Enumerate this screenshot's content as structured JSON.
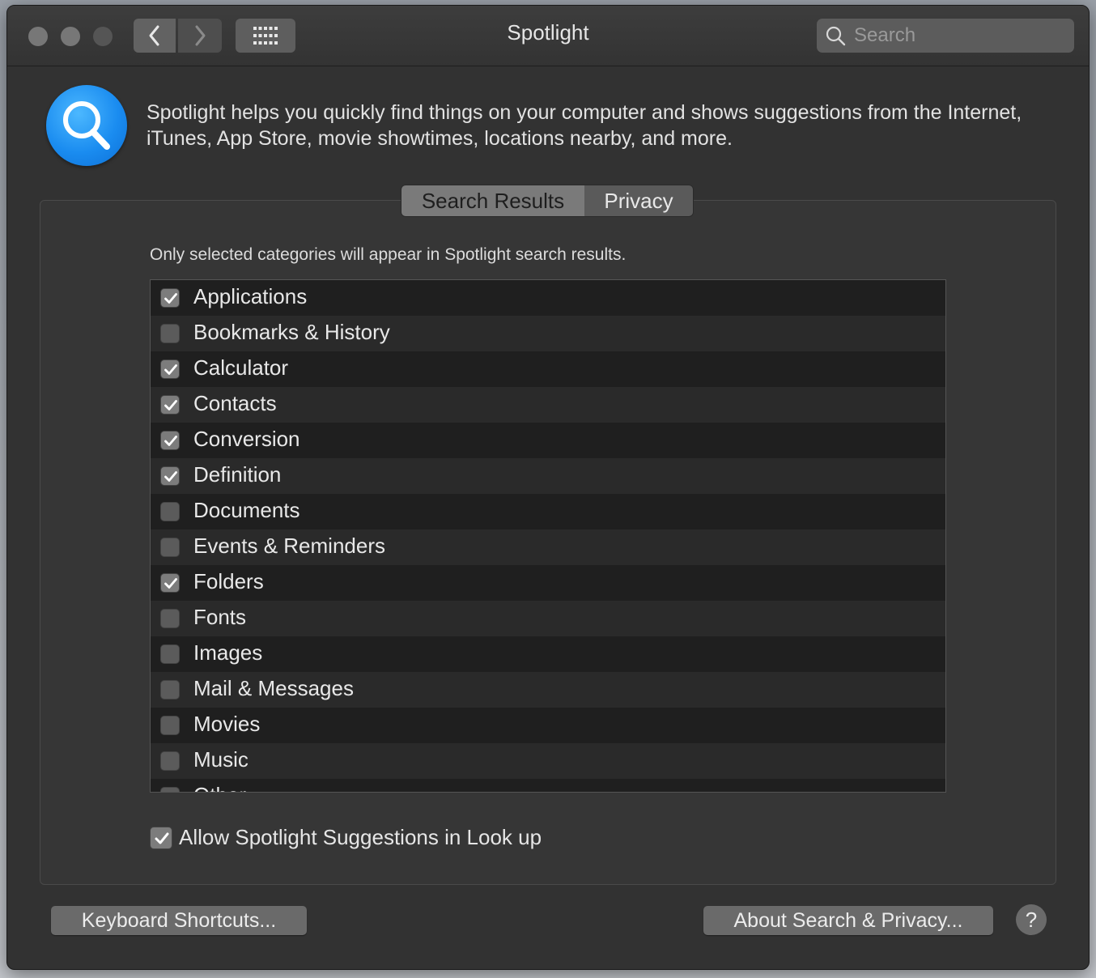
{
  "window": {
    "title": "Spotlight"
  },
  "toolbar": {
    "search_placeholder": "Search"
  },
  "header": {
    "description": "Spotlight helps you quickly find things on your computer and shows suggestions from the Internet, iTunes, App Store, movie showtimes, locations nearby, and more."
  },
  "tabs": [
    {
      "label": "Search Results",
      "selected": true
    },
    {
      "label": "Privacy",
      "selected": false
    }
  ],
  "hint": "Only selected categories will appear in Spotlight search results.",
  "categories": [
    {
      "label": "Applications",
      "checked": true
    },
    {
      "label": "Bookmarks & History",
      "checked": false
    },
    {
      "label": "Calculator",
      "checked": true
    },
    {
      "label": "Contacts",
      "checked": true
    },
    {
      "label": "Conversion",
      "checked": true
    },
    {
      "label": "Definition",
      "checked": true
    },
    {
      "label": "Documents",
      "checked": false
    },
    {
      "label": "Events & Reminders",
      "checked": false
    },
    {
      "label": "Folders",
      "checked": true
    },
    {
      "label": "Fonts",
      "checked": false
    },
    {
      "label": "Images",
      "checked": false
    },
    {
      "label": "Mail & Messages",
      "checked": false
    },
    {
      "label": "Movies",
      "checked": false
    },
    {
      "label": "Music",
      "checked": false
    },
    {
      "label": "Other",
      "checked": false
    }
  ],
  "allow_suggestions": {
    "label": "Allow Spotlight Suggestions in Look up",
    "checked": true
  },
  "buttons": {
    "keyboard_shortcuts": "Keyboard Shortcuts...",
    "about": "About Search & Privacy...",
    "help": "?"
  }
}
